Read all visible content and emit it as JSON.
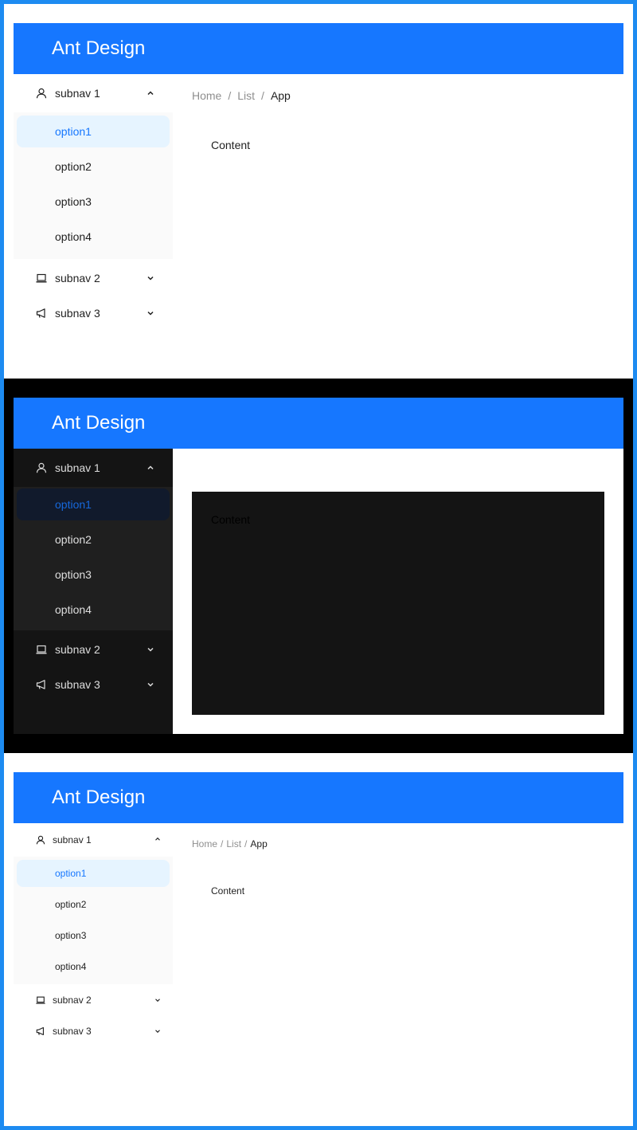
{
  "colors": {
    "frame_border": "#1d8bf1",
    "header_bg": "#1677ff",
    "selected_bg_light": "#e6f4ff",
    "selected_text": "#1677ff",
    "dark_sider_bg": "#141414",
    "dark_submenu_bg": "#1f1f1f"
  },
  "header": {
    "logo_text": "Ant Design"
  },
  "menu": {
    "subnav1": {
      "label": "subnav 1",
      "icon": "user-icon",
      "expanded": true
    },
    "subnav2": {
      "label": "subnav 2",
      "icon": "laptop-icon",
      "expanded": false
    },
    "subnav3": {
      "label": "subnav 3",
      "icon": "notification-icon",
      "expanded": false
    },
    "options": [
      "option1",
      "option2",
      "option3",
      "option4"
    ],
    "selected": "option1"
  },
  "breadcrumb": {
    "items": [
      "Home",
      "List",
      "App"
    ],
    "separator": "/"
  },
  "content": {
    "text": "Content"
  },
  "variants": [
    "light",
    "dark",
    "light-small"
  ]
}
